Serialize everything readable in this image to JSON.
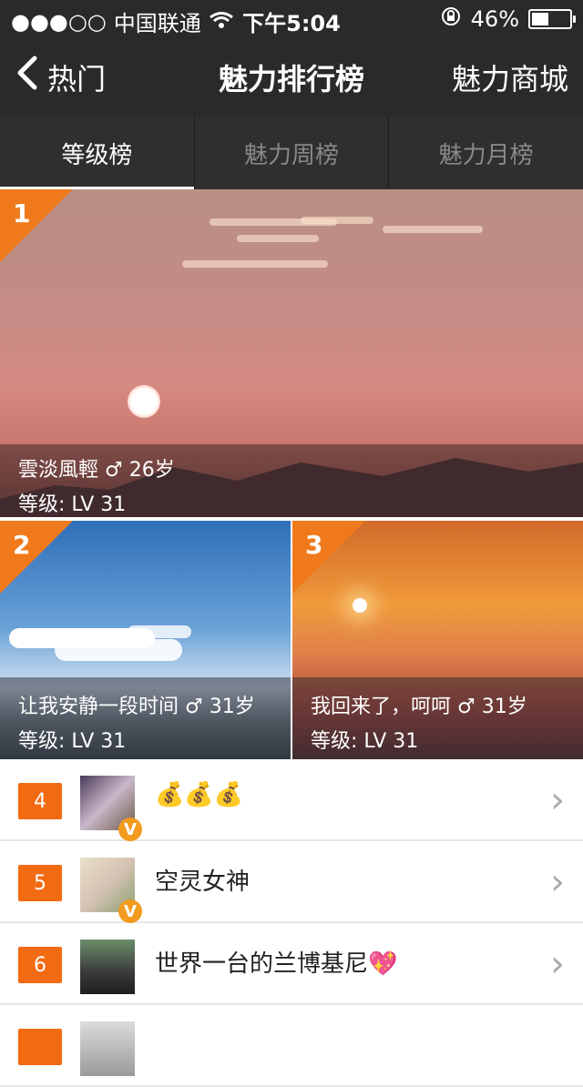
{
  "status": {
    "signal": "●●●○○",
    "carrier": "中国联通",
    "time": "下午5:04",
    "battery": "46%"
  },
  "nav": {
    "back_label": "热门",
    "title": "魅力排行榜",
    "right_label": "魅力商城"
  },
  "tabs": [
    "等级榜",
    "魅力周榜",
    "魅力月榜"
  ],
  "top": [
    {
      "rank": "1",
      "line1": "雲淡風輕 ♂ 26岁",
      "line2": "等级: LV 31"
    },
    {
      "rank": "2",
      "line1": "让我安静一段时间 ♂ 31岁",
      "line2": "等级: LV 31"
    },
    {
      "rank": "3",
      "line1": "我回来了，呵呵 ♂ 31岁",
      "line2": "等级: LV 31"
    }
  ],
  "list": [
    {
      "rank": "4",
      "name": "💰💰💰",
      "verified": true
    },
    {
      "rank": "5",
      "name": "空灵女神",
      "verified": true
    },
    {
      "rank": "6",
      "name": "世界一台的兰博基尼💖",
      "verified": false
    },
    {
      "rank": "",
      "name": "",
      "verified": false
    }
  ],
  "colors": {
    "accent": "#f26a12",
    "bar_bg": "#2a2a2a"
  }
}
